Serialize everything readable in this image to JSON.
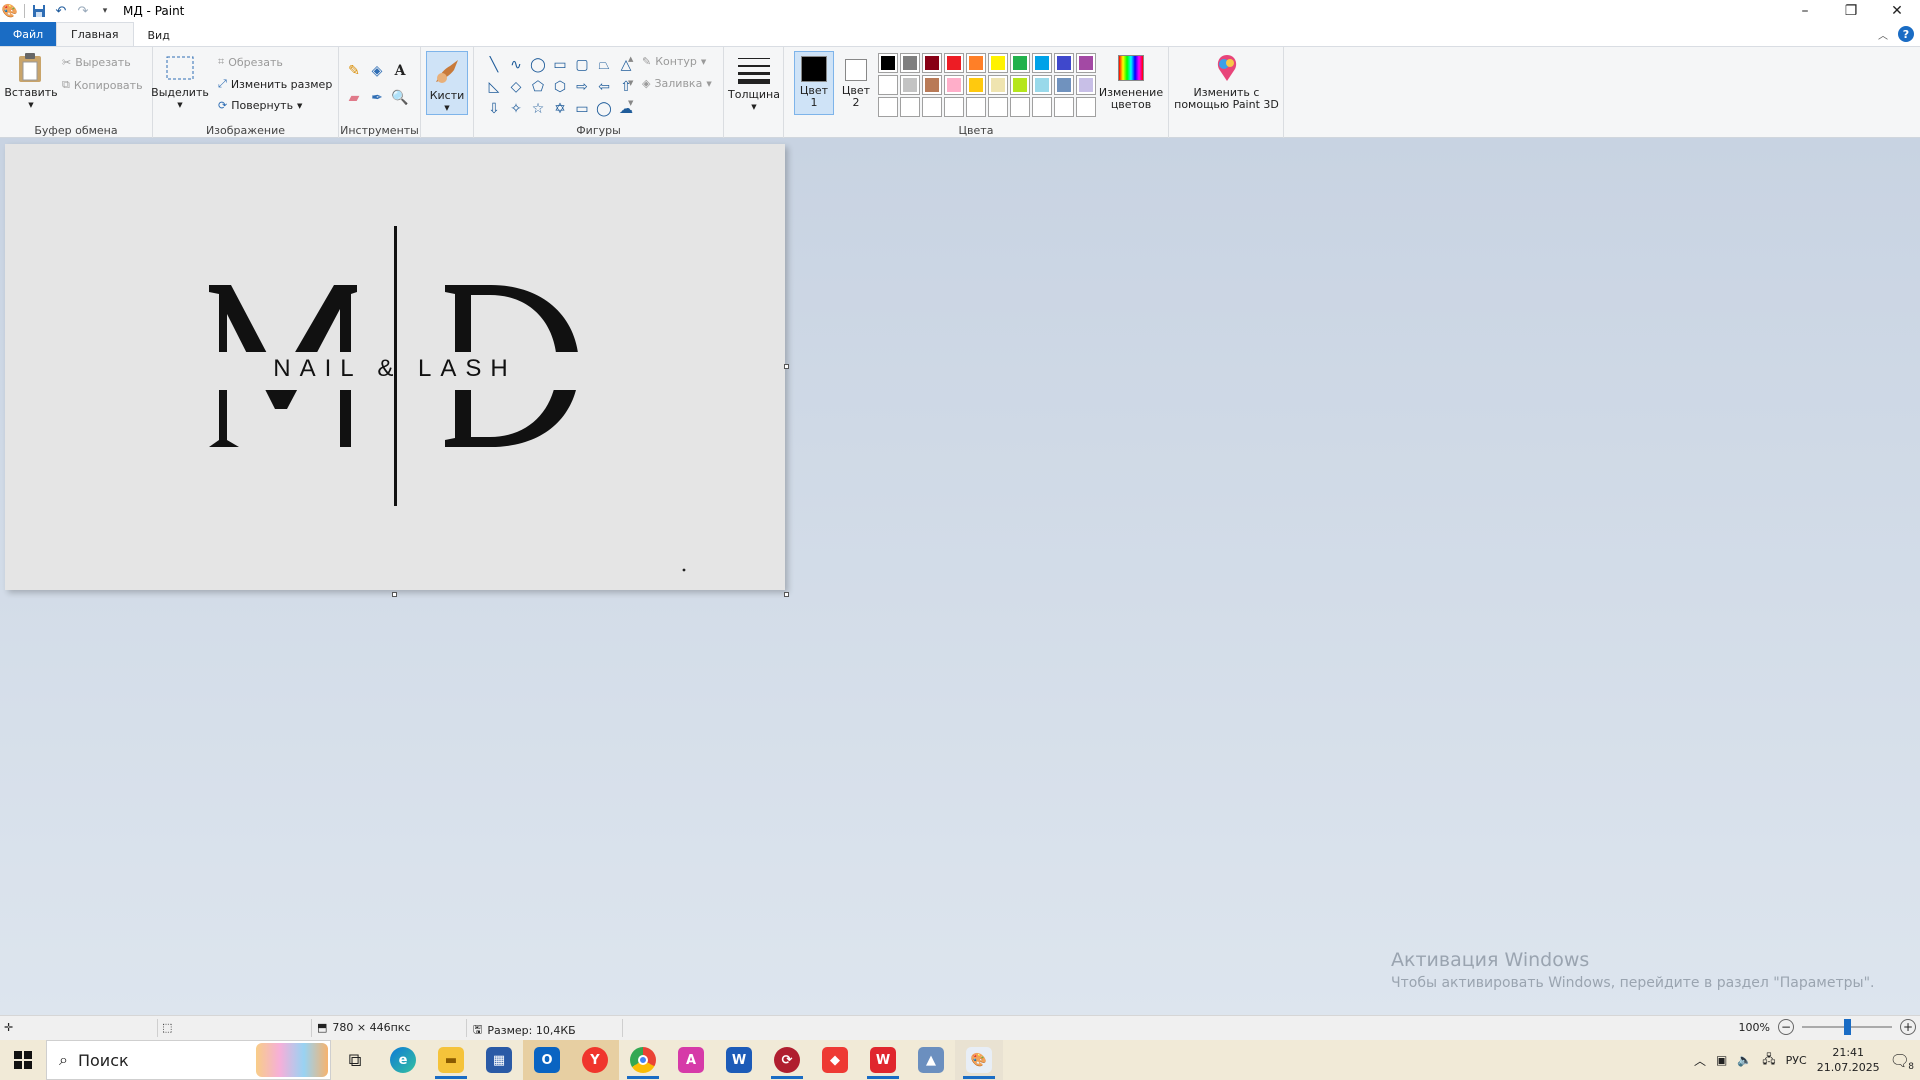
{
  "app": {
    "title": "МД - Paint"
  },
  "tabs": [
    "Файл",
    "Главная",
    "Вид"
  ],
  "ribbon": {
    "clipboard": {
      "paste": "Вставить",
      "cut": "Вырезать",
      "copy": "Копировать",
      "label": "Буфер обмена"
    },
    "image": {
      "select": "Выделить",
      "crop": "Обрезать",
      "resize": "Изменить размер",
      "rotate": "Повернуть",
      "label": "Изображение"
    },
    "tools": {
      "label": "Инструменты"
    },
    "brushes": {
      "label": "Кисти"
    },
    "shapes": {
      "outline": "Контур",
      "fill": "Заливка",
      "label": "Фигуры"
    },
    "size": {
      "label": "Толщина"
    },
    "colors": {
      "color1_l1": "Цвет",
      "color1_l2": "1",
      "color2_l1": "Цвет",
      "color2_l2": "2",
      "edit_l1": "Изменение",
      "edit_l2": "цветов",
      "label": "Цвета",
      "palette_row1": [
        "#000000",
        "#7f7f7f",
        "#880015",
        "#ed1c24",
        "#ff7f27",
        "#fff200",
        "#22b14c",
        "#00a2e8",
        "#3f48cc",
        "#a349a4"
      ],
      "palette_row2": [
        "#ffffff",
        "#c3c3c3",
        "#b97a57",
        "#ffaec9",
        "#ffc90e",
        "#efe4b0",
        "#b5e61d",
        "#99d9ea",
        "#7092be",
        "#c8bfe7"
      ]
    },
    "paint3d": {
      "l1": "Изменить с",
      "l2": "помощью Paint 3D"
    }
  },
  "canvas": {
    "logo_letters": "MD",
    "logo_text": "NAIL & LASH"
  },
  "watermark": {
    "line1": "Активация Windows",
    "line2": "Чтобы активировать Windows, перейдите в раздел \"Параметры\"."
  },
  "status": {
    "dimensions": "780 × 446пкс",
    "size": "Размер: 10,4КБ",
    "zoom": "100%"
  },
  "taskbar": {
    "search": "Поиск",
    "lang": "РУС",
    "time": "21:41",
    "date": "21.07.2025",
    "notif": "8"
  }
}
